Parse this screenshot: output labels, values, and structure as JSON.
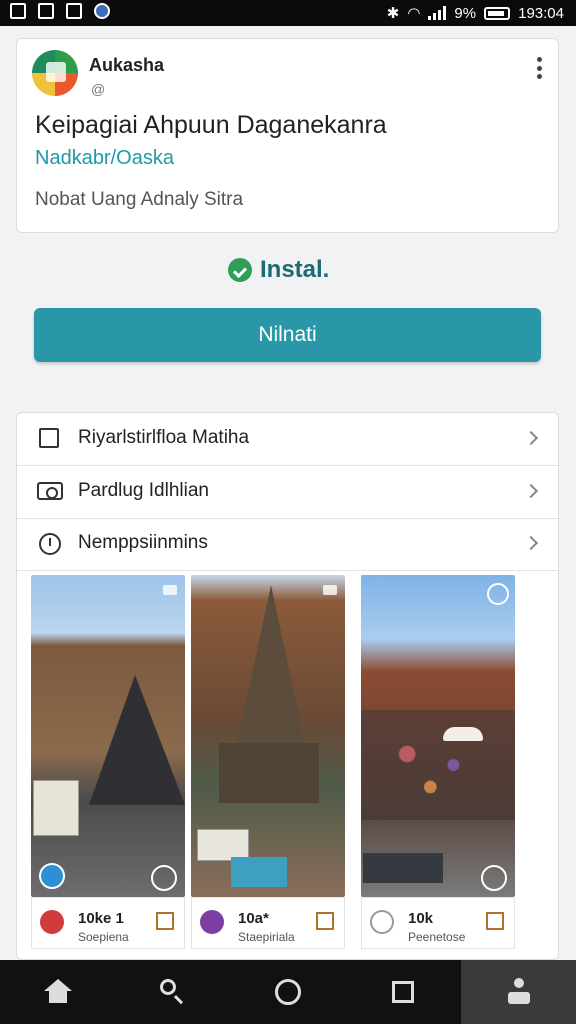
{
  "status_bar": {
    "battery": "9%",
    "time": "193:04"
  },
  "app": {
    "developer": "Aukasha",
    "developer_sub": "@",
    "title": "Keipagiai Ahpuun Daganekanra",
    "category": "Nadkabr/Oaska",
    "description": "Nobat Uang  Adnaly Sitra"
  },
  "install": {
    "label": "Instal.",
    "button": "Nilnati"
  },
  "details": {
    "rows": [
      {
        "label": "Riyarlstirlfloa Matiha",
        "icon": "checkbox-icon"
      },
      {
        "label": "Pardlug Idlhlian",
        "icon": "camera-icon"
      },
      {
        "label": "Nemppsiinmins",
        "icon": "clock-icon"
      }
    ],
    "tiles": [
      {
        "count": "10ke 1",
        "sub": "Soepiena",
        "color": "#d23b3b"
      },
      {
        "count": "10a*",
        "sub": "Staepiriala",
        "color": "#7a3fa0"
      },
      {
        "count": "10k",
        "sub": "Peenetose",
        "color": "#9c9c9c"
      }
    ]
  },
  "navbar": [
    "home-icon",
    "search-icon",
    "circle-icon",
    "square-icon",
    "person-icon"
  ]
}
